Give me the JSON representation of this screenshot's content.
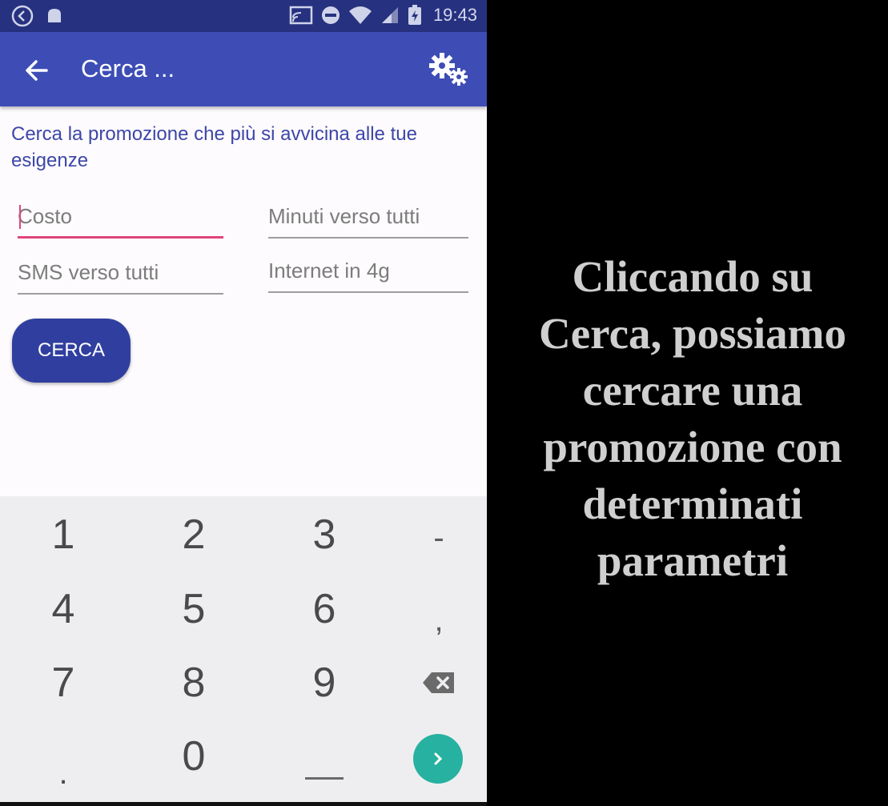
{
  "status_bar": {
    "time": "19:43",
    "icons": [
      "back-circle-icon",
      "android-icon",
      "cast-icon",
      "dnd-icon",
      "wifi-icon",
      "signal-icon",
      "battery-charging-icon"
    ]
  },
  "app_bar": {
    "title": "Cerca ...",
    "back_icon": "arrow-left-icon",
    "settings_icon": "gears-icon"
  },
  "intro_text": "Cerca la promozione che più si avvicina alle tue esigenze",
  "fields": {
    "costo": {
      "placeholder": "Costo",
      "value": ""
    },
    "minuti": {
      "placeholder": "Minuti verso tutti",
      "value": ""
    },
    "sms": {
      "placeholder": "SMS verso tutti",
      "value": ""
    },
    "internet": {
      "placeholder": "Internet in 4g",
      "value": ""
    }
  },
  "search_button": {
    "label": "CERCA"
  },
  "keyboard": {
    "rows": [
      [
        "1",
        "2",
        "3",
        "-"
      ],
      [
        "4",
        "5",
        "6",
        ","
      ],
      [
        "7",
        "8",
        "9",
        "⌫"
      ],
      [
        ".",
        "0",
        "␣",
        "›"
      ]
    ]
  },
  "caption": {
    "lines": [
      "Cliccando su",
      "Cerca, possiamo",
      "cercare una",
      "promozione con",
      "determinati",
      "parametri"
    ]
  },
  "colors": {
    "status_bar": "#26317f",
    "app_bar": "#3d4db5",
    "accent": "#e0457c",
    "button": "#303f9f",
    "go_key": "#27b1a0"
  }
}
